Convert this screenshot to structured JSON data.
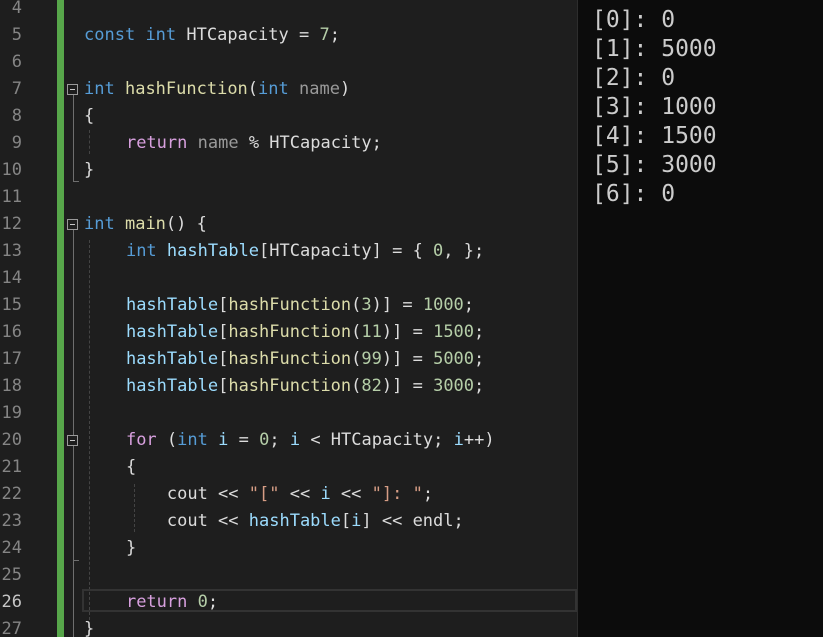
{
  "editor": {
    "line_numbers": [
      "4",
      "5",
      "6",
      "7",
      "8",
      "9",
      "10",
      "11",
      "12",
      "13",
      "14",
      "15",
      "16",
      "17",
      "18",
      "19",
      "20",
      "21",
      "22",
      "23",
      "24",
      "25",
      "26",
      "27"
    ],
    "current_line": "26",
    "lines": {
      "l5": [
        {
          "t": "const",
          "c": "kw"
        },
        {
          "t": " ",
          "c": "pl"
        },
        {
          "t": "int",
          "c": "kw"
        },
        {
          "t": " HTCapacity = ",
          "c": "pl"
        },
        {
          "t": "7",
          "c": "num"
        },
        {
          "t": ";",
          "c": "pl"
        }
      ],
      "l7": [
        {
          "t": "int",
          "c": "kw"
        },
        {
          "t": " ",
          "c": "pl"
        },
        {
          "t": "hashFunction",
          "c": "fn"
        },
        {
          "t": "(",
          "c": "pl"
        },
        {
          "t": "int",
          "c": "kw"
        },
        {
          "t": " ",
          "c": "pl"
        },
        {
          "t": "name",
          "c": "par"
        },
        {
          "t": ")",
          "c": "pl"
        }
      ],
      "l8": [
        {
          "t": "{",
          "c": "pl"
        }
      ],
      "l9": [
        {
          "t": "    ",
          "c": "pl"
        },
        {
          "t": "return",
          "c": "ctl"
        },
        {
          "t": " ",
          "c": "pl"
        },
        {
          "t": "name",
          "c": "par"
        },
        {
          "t": " % HTCapacity;",
          "c": "pl"
        }
      ],
      "l10": [
        {
          "t": "}",
          "c": "pl"
        }
      ],
      "l12": [
        {
          "t": "int",
          "c": "kw"
        },
        {
          "t": " ",
          "c": "pl"
        },
        {
          "t": "main",
          "c": "fn"
        },
        {
          "t": "() {",
          "c": "pl"
        }
      ],
      "l13": [
        {
          "t": "    ",
          "c": "pl"
        },
        {
          "t": "int",
          "c": "kw"
        },
        {
          "t": " ",
          "c": "pl"
        },
        {
          "t": "hashTable",
          "c": "var"
        },
        {
          "t": "[HTCapacity] = { ",
          "c": "pl"
        },
        {
          "t": "0",
          "c": "num"
        },
        {
          "t": ", };",
          "c": "pl"
        }
      ],
      "l15": [
        {
          "t": "    ",
          "c": "pl"
        },
        {
          "t": "hashTable",
          "c": "var"
        },
        {
          "t": "[",
          "c": "pl"
        },
        {
          "t": "hashFunction",
          "c": "fn"
        },
        {
          "t": "(",
          "c": "pl"
        },
        {
          "t": "3",
          "c": "num"
        },
        {
          "t": ")] = ",
          "c": "pl"
        },
        {
          "t": "1000",
          "c": "num"
        },
        {
          "t": ";",
          "c": "pl"
        }
      ],
      "l16": [
        {
          "t": "    ",
          "c": "pl"
        },
        {
          "t": "hashTable",
          "c": "var"
        },
        {
          "t": "[",
          "c": "pl"
        },
        {
          "t": "hashFunction",
          "c": "fn"
        },
        {
          "t": "(",
          "c": "pl"
        },
        {
          "t": "11",
          "c": "num"
        },
        {
          "t": ")] = ",
          "c": "pl"
        },
        {
          "t": "1500",
          "c": "num"
        },
        {
          "t": ";",
          "c": "pl"
        }
      ],
      "l17": [
        {
          "t": "    ",
          "c": "pl"
        },
        {
          "t": "hashTable",
          "c": "var"
        },
        {
          "t": "[",
          "c": "pl"
        },
        {
          "t": "hashFunction",
          "c": "fn"
        },
        {
          "t": "(",
          "c": "pl"
        },
        {
          "t": "99",
          "c": "num"
        },
        {
          "t": ")] = ",
          "c": "pl"
        },
        {
          "t": "5000",
          "c": "num"
        },
        {
          "t": ";",
          "c": "pl"
        }
      ],
      "l18": [
        {
          "t": "    ",
          "c": "pl"
        },
        {
          "t": "hashTable",
          "c": "var"
        },
        {
          "t": "[",
          "c": "pl"
        },
        {
          "t": "hashFunction",
          "c": "fn"
        },
        {
          "t": "(",
          "c": "pl"
        },
        {
          "t": "82",
          "c": "num"
        },
        {
          "t": ")] = ",
          "c": "pl"
        },
        {
          "t": "3000",
          "c": "num"
        },
        {
          "t": ";",
          "c": "pl"
        }
      ],
      "l20": [
        {
          "t": "    ",
          "c": "pl"
        },
        {
          "t": "for",
          "c": "ctl"
        },
        {
          "t": " (",
          "c": "pl"
        },
        {
          "t": "int",
          "c": "kw"
        },
        {
          "t": " ",
          "c": "pl"
        },
        {
          "t": "i",
          "c": "var"
        },
        {
          "t": " = ",
          "c": "pl"
        },
        {
          "t": "0",
          "c": "num"
        },
        {
          "t": "; ",
          "c": "pl"
        },
        {
          "t": "i",
          "c": "var"
        },
        {
          "t": " < HTCapacity; ",
          "c": "pl"
        },
        {
          "t": "i",
          "c": "var"
        },
        {
          "t": "++)",
          "c": "pl"
        }
      ],
      "l21": [
        {
          "t": "    {",
          "c": "pl"
        }
      ],
      "l22": [
        {
          "t": "        cout << ",
          "c": "pl"
        },
        {
          "t": "\"[\"",
          "c": "str"
        },
        {
          "t": " << ",
          "c": "pl"
        },
        {
          "t": "i",
          "c": "var"
        },
        {
          "t": " << ",
          "c": "pl"
        },
        {
          "t": "\"]: \"",
          "c": "str"
        },
        {
          "t": ";",
          "c": "pl"
        }
      ],
      "l23": [
        {
          "t": "        cout << ",
          "c": "pl"
        },
        {
          "t": "hashTable",
          "c": "var"
        },
        {
          "t": "[",
          "c": "pl"
        },
        {
          "t": "i",
          "c": "var"
        },
        {
          "t": "] << endl;",
          "c": "pl"
        }
      ],
      "l24": [
        {
          "t": "    }",
          "c": "pl"
        }
      ],
      "l26": [
        {
          "t": "    ",
          "c": "pl"
        },
        {
          "t": "return",
          "c": "ctl"
        },
        {
          "t": " ",
          "c": "pl"
        },
        {
          "t": "0",
          "c": "num"
        },
        {
          "t": ";",
          "c": "pl"
        }
      ],
      "l27": [
        {
          "t": "}",
          "c": "pl"
        }
      ]
    }
  },
  "console": {
    "lines": [
      "[0]: 0",
      "[1]: 5000",
      "[2]: 0",
      "[3]: 1000",
      "[4]: 1500",
      "[5]: 3000",
      "[6]: 0"
    ]
  }
}
